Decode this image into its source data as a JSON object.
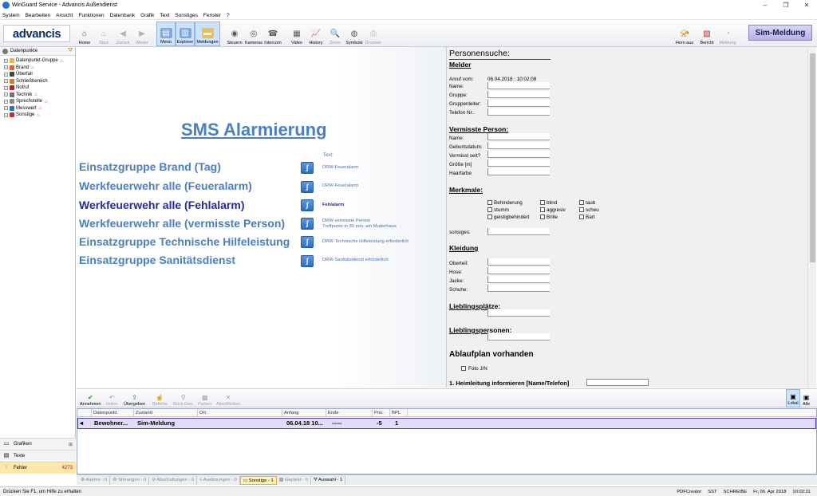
{
  "window": {
    "title": "WinGuard Service - Advancis Außendienst",
    "controls": [
      "–",
      "❐",
      "✕"
    ]
  },
  "menu": [
    "System",
    "Bearbeiten",
    "Ansicht",
    "Funktionen",
    "Datenbank",
    "Grafik",
    "Text",
    "Sonstiges",
    "Fenster",
    "?"
  ],
  "logo": "advancis",
  "toolbar": {
    "home": "Home",
    "start": "Start",
    "back": "Zurück",
    "forward": "Weiter",
    "menu": "Menü",
    "explorer": "Explorer",
    "messages": "Meldungen",
    "control": "Steuern",
    "cameras": "Kameras",
    "intercom": "Intercom",
    "video": "Video",
    "history": "History",
    "zoom": "Zoom",
    "symbols": "Symbole",
    "print": "Drucken",
    "horn_off": "Horn aus",
    "report": "Bericht",
    "message": "Meldung",
    "sim_message": "Sim-Meldung"
  },
  "left_panel": {
    "header": "Datenpunkte",
    "tree": [
      {
        "label": "Datenpunkt-Gruppe",
        "color": "#e6b84a"
      },
      {
        "label": "Brand",
        "color": "#e06030"
      },
      {
        "label": "Überfall",
        "color": "#444444"
      },
      {
        "label": "Schließbereich",
        "color": "#d08020"
      },
      {
        "label": "Notruf",
        "color": "#c02020"
      },
      {
        "label": "Technik",
        "color": "#707070"
      },
      {
        "label": "Sprechstelle",
        "color": "#8a8a8a"
      },
      {
        "label": "Messwert",
        "color": "#3070c0"
      },
      {
        "label": "Sonstige",
        "color": "#c03030"
      }
    ],
    "bottom": [
      {
        "label": "Grafiken",
        "count": ""
      },
      {
        "label": "Texte",
        "count": ""
      },
      {
        "label": "Fehler",
        "count": "4273"
      }
    ]
  },
  "sms": {
    "title": "SMS Alarmierung",
    "text_header": "Text:",
    "rows": [
      {
        "label": "Einsatzgruppe Brand (Tag)",
        "text1": "DRW-Feueralarm",
        "text2": ""
      },
      {
        "label": "Werkfeuerwehr alle (Feueralarm)",
        "text1": "DRW-Feueralarm",
        "text2": ""
      },
      {
        "label": "Werkfeuerwehr alle (Fehlalarm)",
        "text1": "Fehlalarm",
        "text2": ""
      },
      {
        "label": "Werkfeuerwehr alle (vermisste Person)",
        "text1": "DRW-vermisste Person",
        "text2": "Treffpunkt in 30 min. am Mutterhaus"
      },
      {
        "label": "Einsatzgruppe Technische Hilfeleistung",
        "text1": "DRW-Technische Hilfeleistung erforderlich",
        "text2": ""
      },
      {
        "label": "Einsatzgruppe Sanitätsdienst",
        "text1": "DRW-Sanitätsdienst erforderlich",
        "text2": ""
      }
    ]
  },
  "form": {
    "title": "Personensuche:",
    "melder": {
      "heading": "Melder",
      "call_label": "Anruf vom:",
      "call_value": "06.04.2018 : 10:02:08",
      "fields": [
        "Name:",
        "Gruppe:",
        "Gruppenleiter:",
        "Telefon Nr.:"
      ]
    },
    "missing": {
      "heading": "Vermisste Person:",
      "fields": [
        "Name:",
        "Geburtsdatum:",
        "Vermisst seit?",
        "Größe [m]",
        "Haarfarbe"
      ]
    },
    "features": {
      "heading": "Merkmale:",
      "options": [
        "Behinderung",
        "blind",
        "taub",
        "stumm",
        "aggresiv",
        "scheu",
        "geistigbehindert",
        "Brille",
        "Bart"
      ],
      "other_label": "sonsiges:"
    },
    "clothing": {
      "heading": "Kleidung",
      "fields": [
        "Oberteil:",
        "Hose:",
        "Jacke:",
        "Schuhe:"
      ]
    },
    "places": {
      "heading": "Lieblingsplätze:"
    },
    "persons": {
      "heading": "Lieblingspersonen:"
    },
    "plan": {
      "heading": "Ablaufplan vorhanden",
      "photo": "Foto J/N",
      "step1": "1. Heimleitung informieren [Name/Telefon]"
    }
  },
  "lower_toolbar": {
    "accept": "Annehmen",
    "fetch": "Holen",
    "handover": "Übergeben",
    "commands": "Befehle",
    "reset": "Rück.Ges.",
    "park": "Parken",
    "close": "Abschließen",
    "local": "Lokal",
    "all": "Alle"
  },
  "grid": {
    "columns": [
      "Datenpunkt",
      "Zustand",
      "Ort",
      "Anfang",
      "Ende",
      "Prio.",
      "BPL"
    ],
    "row": {
      "datenpunkt": "Bewohner...",
      "zustand": "Sim-Meldung",
      "ort": "",
      "anfang": "06.04.18  10...",
      "ende": "-----",
      "prio": "-5",
      "bpl": "1"
    }
  },
  "tabs": [
    "Alarme - 0",
    "Störungen - 0",
    "Abschaltungen - 0",
    "Auslösungen - 0",
    "Sonstige - 1",
    "Geparkt - 0",
    "Auswahl - 1"
  ],
  "status": {
    "hint": "Drücken Sie F1, um Hilfe zu erhalten",
    "right": [
      "PDFCreator",
      "SST",
      "SCHREIBE",
      "Fr, 06. Apr 2018",
      "10:02:31"
    ]
  }
}
